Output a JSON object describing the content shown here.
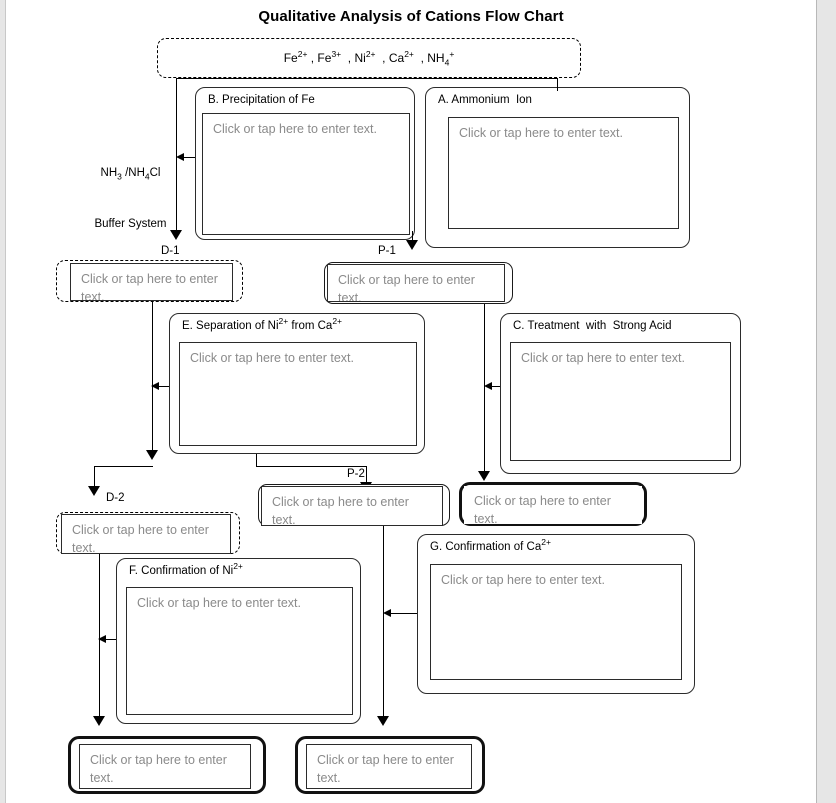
{
  "document": {
    "title": "Qualitative Analysis of Cations Flow Chart"
  },
  "sample": {
    "label_parts": [
      "Fe",
      "2+",
      " , Fe",
      "3+",
      "  , Ni",
      "2+",
      "  , Ca",
      "2+",
      "  , NH",
      "4",
      "+"
    ],
    "label_plain": "Fe2+ , Fe3+  , Ni2+  , Ca2+  , NH4+"
  },
  "reagent_note": {
    "line1_parts": [
      "NH",
      "3",
      " /NH",
      "4",
      "Cl"
    ],
    "line2": "Buffer System"
  },
  "placeholder": "Click or tap here to enter text.",
  "edge_labels": {
    "d1": "D-1",
    "p1": "P-1",
    "d2": "D-2",
    "p2": "P-2"
  },
  "stages": [
    {
      "id": "B",
      "title": "B. Precipitation of Fe",
      "value": "Click or tap here to enter text."
    },
    {
      "id": "A",
      "title": "A. Ammonium  Ion",
      "value": "Click or tap here to enter text."
    },
    {
      "id": "E",
      "title_parts": [
        "E. Separation of Ni",
        "2+",
        " from Ca",
        "2+"
      ],
      "title_plain": "E. Separation of Ni2+ from Ca2+",
      "value": "Click or tap here to enter text."
    },
    {
      "id": "C",
      "title": "C. Treatment  with  Strong Acid",
      "value": "Click or tap here to enter text."
    },
    {
      "id": "F",
      "title_parts": [
        "F. Confirmation of Ni",
        "2+"
      ],
      "title_plain": "F. Confirmation of Ni2+",
      "value": "Click or tap here to enter text."
    },
    {
      "id": "G",
      "title_parts": [
        "G. Confirmation of Ca",
        "2+"
      ],
      "title_plain": "G. Confirmation of Ca2+",
      "value": "Click or tap here to enter text."
    }
  ],
  "nodes": {
    "d1": "Click or tap here to enter text.",
    "p1": "Click or tap here to enter text.",
    "d2": "Click or tap here to enter text.",
    "p2": "Click or tap here to enter text.",
    "p1_result": "Click or tap here to enter text.",
    "final_left": "Click or tap here to enter text.",
    "final_right": "Click or tap here to enter text."
  },
  "colors": {
    "page_background": "#ffffff",
    "app_background": "#e6e6e6",
    "ink": "#000000",
    "placeholder_text": "#8a8a8a",
    "box_border": "#2b2b2b"
  }
}
